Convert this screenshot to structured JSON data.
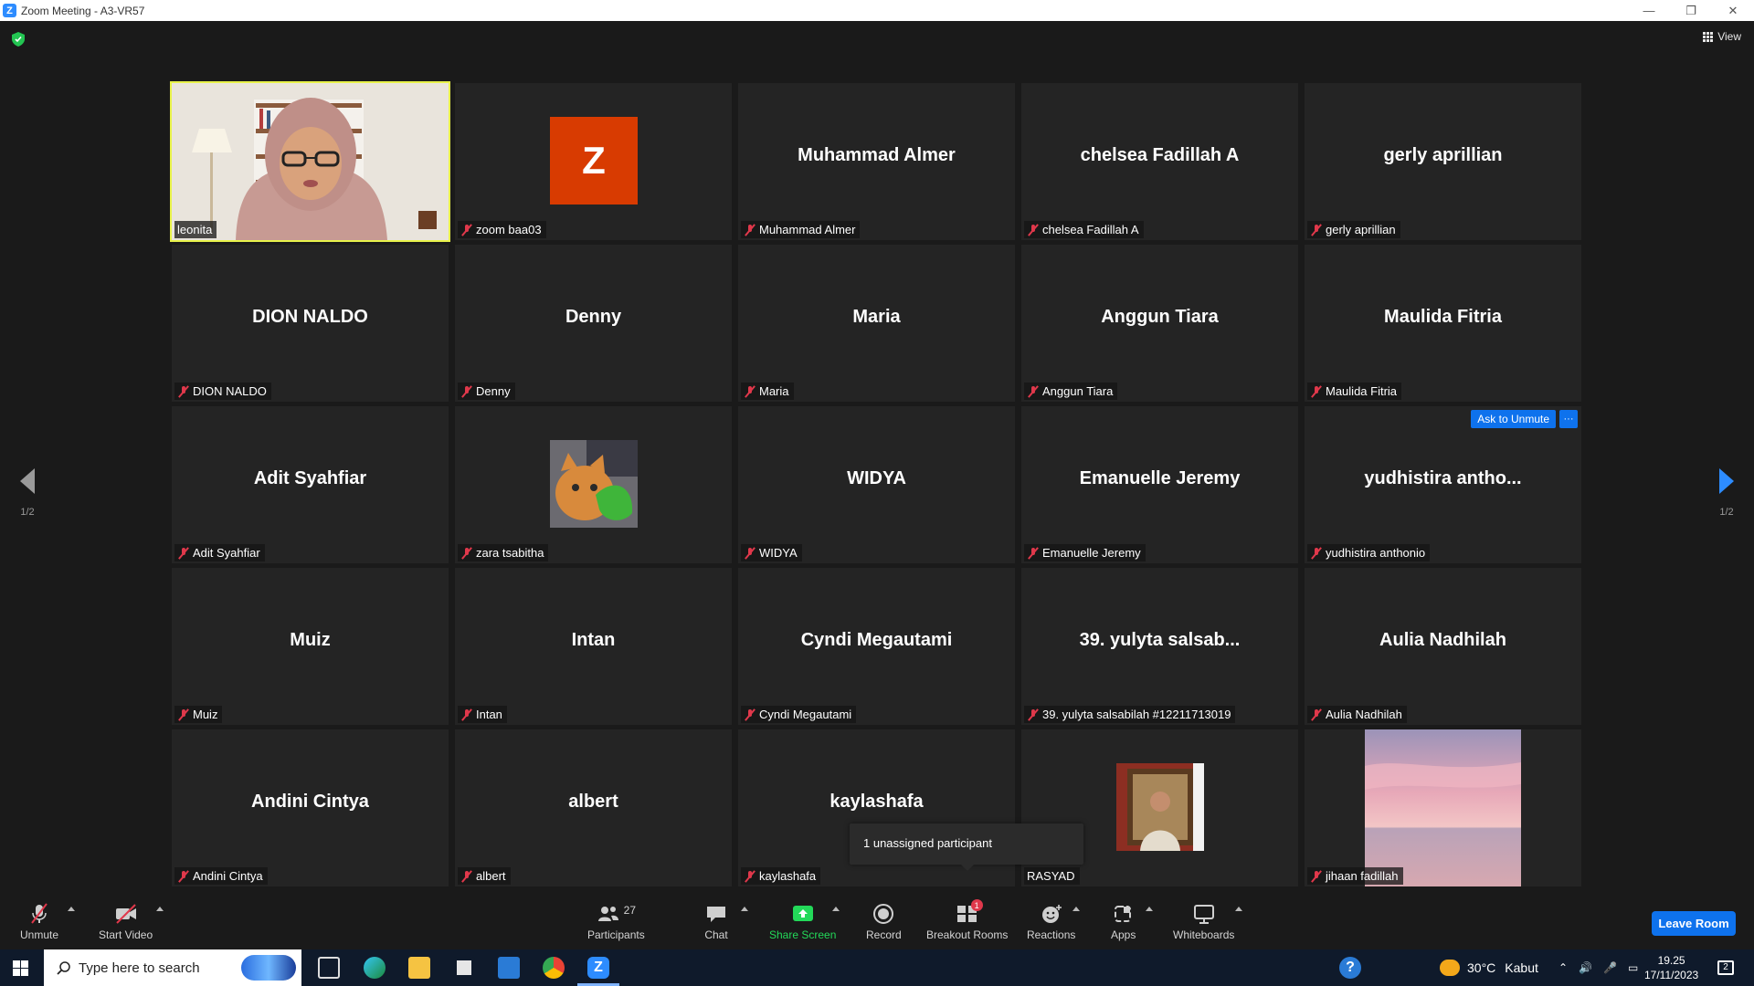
{
  "window": {
    "title": "Zoom Meeting - A3-VR57"
  },
  "header": {
    "view_label": "View"
  },
  "pagination": {
    "left": "1/2",
    "right": "1/2"
  },
  "tiles": [
    {
      "name": "",
      "label": "leonita",
      "type": "video",
      "muted": false,
      "active": true
    },
    {
      "name": "",
      "label": "zoom baa03",
      "type": "avatar-letter",
      "letter": "Z",
      "muted": true
    },
    {
      "name": "Muhammad Almer",
      "label": "Muhammad Almer",
      "type": "name",
      "muted": true
    },
    {
      "name": "chelsea Fadillah A",
      "label": "chelsea Fadillah A",
      "type": "name",
      "muted": true
    },
    {
      "name": "gerly aprillian",
      "label": "gerly aprillian",
      "type": "name",
      "muted": true
    },
    {
      "name": "DION NALDO",
      "label": "DION NALDO",
      "type": "name",
      "muted": true
    },
    {
      "name": "Denny",
      "label": "Denny",
      "type": "name",
      "muted": true
    },
    {
      "name": "Maria",
      "label": "Maria",
      "type": "name",
      "muted": true
    },
    {
      "name": "Anggun Tiara",
      "label": "Anggun Tiara",
      "type": "name",
      "muted": true
    },
    {
      "name": "Maulida Fitria",
      "label": "Maulida Fitria",
      "type": "name",
      "muted": true
    },
    {
      "name": "Adit Syahfiar",
      "label": "Adit Syahfiar",
      "type": "name",
      "muted": true
    },
    {
      "name": "",
      "label": "zara tsabitha",
      "type": "avatar-cat",
      "muted": true
    },
    {
      "name": "WIDYA",
      "label": "WIDYA",
      "type": "name",
      "muted": true
    },
    {
      "name": "Emanuelle Jeremy",
      "label": "Emanuelle Jeremy",
      "type": "name",
      "muted": true
    },
    {
      "name": "yudhistira  antho...",
      "label": "yudhistira anthonio",
      "type": "name",
      "muted": true,
      "hover": true
    },
    {
      "name": "Muiz",
      "label": "Muiz",
      "type": "name",
      "muted": true
    },
    {
      "name": "Intan",
      "label": "Intan",
      "type": "name",
      "muted": true
    },
    {
      "name": "Cyndi Megautami",
      "label": "Cyndi Megautami",
      "type": "name",
      "muted": true
    },
    {
      "name": "39. yulyta salsab...",
      "label": "39. yulyta salsabilah #12211713019",
      "type": "name",
      "muted": true
    },
    {
      "name": "Aulia Nadhilah",
      "label": "Aulia Nadhilah",
      "type": "name",
      "muted": true
    },
    {
      "name": "Andini Cintya",
      "label": "Andini Cintya",
      "type": "name",
      "muted": true
    },
    {
      "name": "albert",
      "label": "albert",
      "type": "name",
      "muted": true
    },
    {
      "name": "kaylashafa",
      "label": "kaylashafa",
      "type": "name",
      "muted": true
    },
    {
      "name": "",
      "label": "RASYAD",
      "type": "avatar-person",
      "muted": false
    },
    {
      "name": "",
      "label": "jihaan fadillah",
      "type": "sky",
      "muted": true
    }
  ],
  "hover_actions": {
    "ask_to_unmute": "Ask to Unmute",
    "more": "···"
  },
  "tooltip": "1 unassigned participant",
  "toolbar": {
    "unmute": "Unmute",
    "start_video": "Start Video",
    "participants": "Participants",
    "participants_count": "27",
    "chat": "Chat",
    "share_screen": "Share Screen",
    "record": "Record",
    "breakout_rooms": "Breakout Rooms",
    "breakout_badge": "1",
    "reactions": "Reactions",
    "apps": "Apps",
    "whiteboards": "Whiteboards",
    "leave": "Leave Room"
  },
  "taskbar": {
    "search_placeholder": "Type here to search",
    "weather_temp": "30°C",
    "weather_desc": "Kabut",
    "time": "19.25",
    "date": "17/11/2023",
    "notifications": "2"
  },
  "colors": {
    "accent": "#0e72ed",
    "share_green": "#23d959",
    "muted_red": "#e0384b",
    "active_border": "#e8f24a"
  }
}
